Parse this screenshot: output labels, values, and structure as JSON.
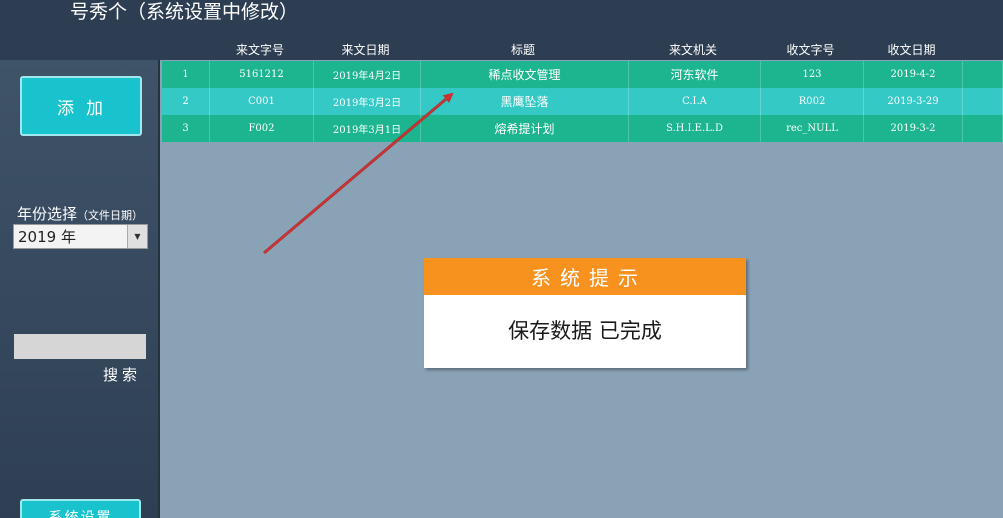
{
  "app": {
    "title": "号秀个（系统设置中修改）"
  },
  "table": {
    "headers": [
      "",
      "来文字号",
      "来文日期",
      "标题",
      "来文机关",
      "收文字号",
      "收文日期",
      ""
    ],
    "rows": [
      [
        "1",
        "5161212",
        "2019年4月2日",
        "稀点收文管理",
        "河东软件",
        "123",
        "2019-4-2"
      ],
      [
        "2",
        "C001",
        "2019年3月2日",
        "黑鹰坠落",
        "C.I.A",
        "R002",
        "2019-3-29"
      ],
      [
        "3",
        "F002",
        "2019年3月1日",
        "熔希提计划",
        "S.H.I.E.L.D",
        "rec_NULL",
        "2019-3-2"
      ]
    ]
  },
  "sidebar": {
    "add_label": "添加",
    "year_label": "年份选择",
    "year_sub": "（文件日期）",
    "year_value": "2019 年",
    "search_value": "",
    "search_label": "搜索",
    "settings_label": "系统设置"
  },
  "dialog": {
    "title": "系统提示",
    "message": "保存数据 已完成"
  },
  "colors": {
    "row_odd": "#1cb590",
    "row_even": "#35c9c6",
    "dialog_header": "#f7921e",
    "accent_button": "#19c3cd",
    "annotation_arrow": "#d42020"
  }
}
